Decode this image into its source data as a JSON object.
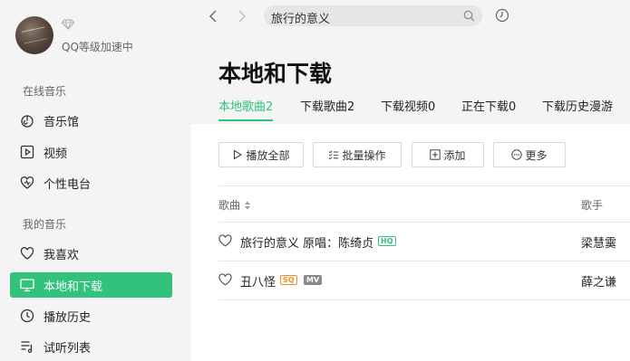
{
  "sidebar": {
    "profile": {
      "vip_text": "QQ等级加速中"
    },
    "sections": {
      "online": "在线音乐",
      "mine": "我的音乐"
    },
    "items": [
      {
        "label": "音乐馆",
        "icon": "music-hall-icon"
      },
      {
        "label": "视频",
        "icon": "video-icon"
      },
      {
        "label": "个性电台",
        "icon": "radio-icon"
      },
      {
        "label": "我喜欢",
        "icon": "heart-icon"
      },
      {
        "label": "本地和下载",
        "icon": "monitor-icon",
        "active": true
      },
      {
        "label": "播放历史",
        "icon": "clock-icon"
      },
      {
        "label": "试听列表",
        "icon": "playlist-icon"
      }
    ]
  },
  "header": {
    "search_value": "旅行的意义"
  },
  "main": {
    "title": "本地和下载",
    "tabs": [
      {
        "label": "本地歌曲2",
        "active": true
      },
      {
        "label": "下载歌曲2"
      },
      {
        "label": "下载视频0"
      },
      {
        "label": "正在下载0"
      },
      {
        "label": "下载历史漫游"
      }
    ],
    "toolbar": {
      "play_all": "播放全部",
      "batch": "批量操作",
      "add": "添加",
      "more": "更多"
    },
    "columns": {
      "song": "歌曲",
      "singer": "歌手"
    },
    "songs": [
      {
        "name": "旅行的意义 原唱：陈绮贞",
        "tags": [
          "HQ"
        ],
        "singer": "梁慧霙"
      },
      {
        "name": "丑八怪",
        "tags": [
          "SQ",
          "MV"
        ],
        "singer": "薛之谦"
      }
    ]
  },
  "colors": {
    "accent": "#31c27c",
    "sq": "#f08a24",
    "sidebar_bg": "#f4f4f4"
  }
}
